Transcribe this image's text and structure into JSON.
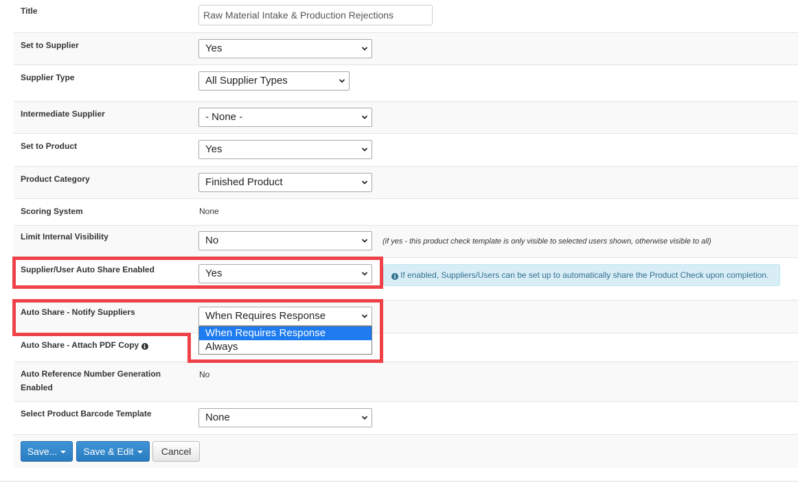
{
  "form": {
    "title": {
      "label": "Title",
      "value": "Raw Material Intake & Production Rejections"
    },
    "set_to_supplier": {
      "label": "Set to Supplier",
      "value": "Yes"
    },
    "supplier_type": {
      "label": "Supplier Type",
      "value": "All Supplier Types"
    },
    "intermediate_supplier": {
      "label": "Intermediate Supplier",
      "value": "- None -"
    },
    "set_to_product": {
      "label": "Set to Product",
      "value": "Yes"
    },
    "product_category": {
      "label": "Product Category",
      "value": "Finished Product"
    },
    "scoring_system": {
      "label": "Scoring System",
      "value": "None"
    },
    "limit_internal_visibility": {
      "label": "Limit Internal Visibility",
      "value": "No",
      "hint": "(if yes - this product check template is only visible to selected users shown, otherwise visible to all)"
    },
    "auto_share_enabled": {
      "label": "Supplier/User Auto Share Enabled",
      "value": "Yes",
      "info": "If enabled, Suppliers/Users can be set up to automatically share the Product Check upon completion."
    },
    "auto_share_notify": {
      "label": "Auto Share - Notify Suppliers",
      "value": "When Requires Response",
      "options": [
        "When Requires Response",
        "Always"
      ]
    },
    "auto_share_attach_pdf": {
      "label": "Auto Share - Attach PDF Copy"
    },
    "auto_reference": {
      "label_line1": "Auto Reference Number Generation",
      "label_line2": "Enabled",
      "value": "No"
    },
    "barcode_template": {
      "label": "Select Product Barcode Template",
      "value": "None"
    }
  },
  "buttons": {
    "save": "Save...",
    "save_edit": "Save & Edit",
    "cancel": "Cancel"
  },
  "colors": {
    "highlight": "#ee4248",
    "primary": "#2a7cc0",
    "selected_option": "#1e7bf0",
    "info_bg": "#d9edf7"
  },
  "icons": {
    "chevron": "chevron-down-icon",
    "info": "info-circle-icon",
    "caret": "caret-down-icon"
  }
}
